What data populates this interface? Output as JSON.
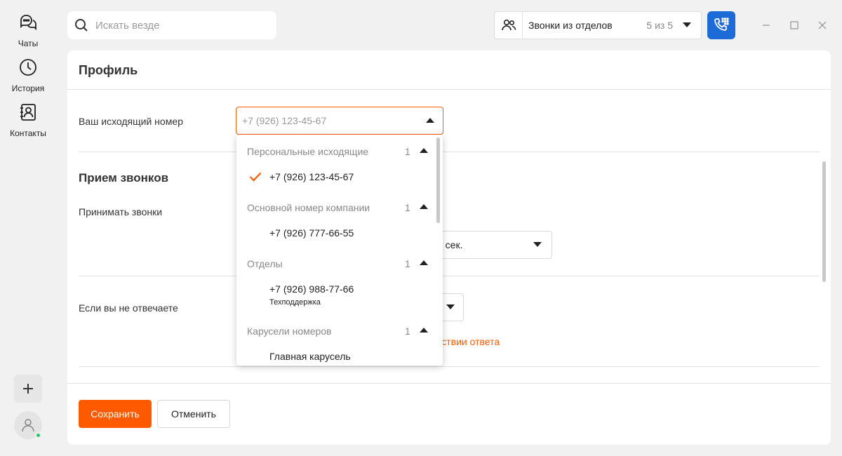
{
  "rail": {
    "items": [
      {
        "label": "Чаты",
        "icon": "chats-icon"
      },
      {
        "label": "История",
        "icon": "history-icon"
      },
      {
        "label": "Контакты",
        "icon": "contacts-icon"
      }
    ],
    "add_icon": "plus-icon",
    "avatar_icon": "user-icon",
    "status_color": "#2cc66b"
  },
  "search": {
    "placeholder": "Искать везде"
  },
  "calls_filter": {
    "label": "Звонки из отделов",
    "count": "5 из 5"
  },
  "accent": {
    "orange": "#ff5a00",
    "blue": "#1d6bd6"
  },
  "profile": {
    "title": "Профиль",
    "outgoing_label": "Ваш исходящий номер",
    "outgoing_value": "+7 (926) 123-45-67"
  },
  "receive": {
    "title": "Прием звонков",
    "accept_label": "Принимать звонки",
    "accept_select_value": "0 сек.",
    "no_answer_label": "Если вы не отвечаете",
    "warning_text": "утствии ответа"
  },
  "buttons": {
    "save": "Сохранить",
    "cancel": "Отменить"
  },
  "dropdown": {
    "groups": [
      {
        "name": "Персональные исходящие",
        "count": "1",
        "items": [
          {
            "number": "+7 (926) 123-45-67",
            "selected": true
          }
        ]
      },
      {
        "name": "Основной номер компании",
        "count": "1",
        "items": [
          {
            "number": "+7 (926) 777-66-55"
          }
        ]
      },
      {
        "name": "Отделы",
        "count": "1",
        "items": [
          {
            "number": "+7 (926) 988-77-66",
            "sub": "Техподдержка"
          }
        ]
      },
      {
        "name": "Карусели номеров",
        "count": "1",
        "items": [
          {
            "number": "Главная карусель"
          }
        ]
      }
    ]
  }
}
